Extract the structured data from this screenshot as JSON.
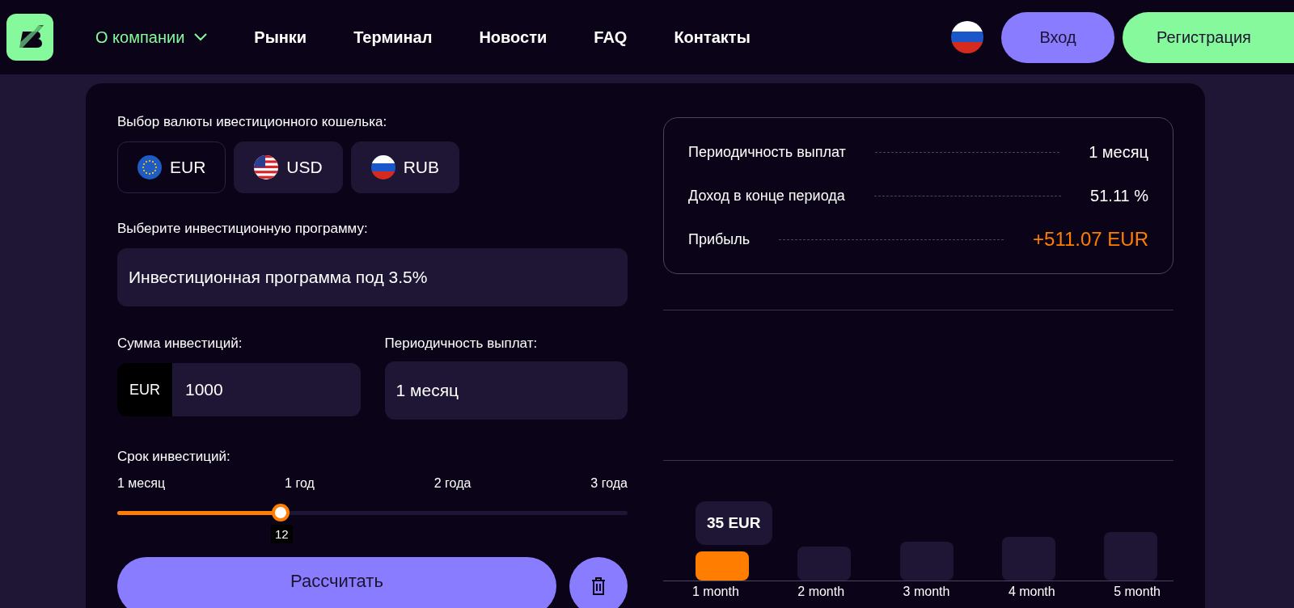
{
  "nav": {
    "items": [
      {
        "label": "О компании",
        "dropdown": true,
        "selected": true
      },
      {
        "label": "Рынки",
        "dropdown": false,
        "selected": false
      },
      {
        "label": "Терминал",
        "dropdown": false,
        "selected": false
      },
      {
        "label": "Новости",
        "dropdown": false,
        "selected": false
      },
      {
        "label": "FAQ",
        "dropdown": false,
        "selected": false
      },
      {
        "label": "Контакты",
        "dropdown": false,
        "selected": false
      }
    ],
    "login": "Вход",
    "register": "Регистрация"
  },
  "calculator": {
    "currency_label": "Выбор валюты ивестиционного кошелька:",
    "currencies": [
      {
        "code": "EUR",
        "kind": "eu",
        "selected": true
      },
      {
        "code": "USD",
        "kind": "us",
        "selected": false
      },
      {
        "code": "RUB",
        "kind": "ru",
        "selected": false
      }
    ],
    "program_label": "Выберите инвестиционную программу:",
    "program": "Инвестиционная программа под 3.5%",
    "amount_label": "Сумма инвестиций:",
    "amount_currency": "EUR",
    "amount": "1000",
    "period_label": "Периодичность выплат:",
    "period": "1 месяц",
    "term_label": "Срок инвестиций:",
    "term_ticks": [
      "1 месяц",
      "1 год",
      "2 года",
      "3 года"
    ],
    "term": {
      "level": 0.32,
      "value": "12"
    },
    "calculate": "Рассчитать"
  },
  "results": {
    "rows": [
      {
        "label": "Периодичность выплат",
        "value": "1 месяц",
        "highlight": false
      },
      {
        "label": "Доход в конце периода",
        "value": "51.11 %",
        "highlight": false
      },
      {
        "label": "Прибыль",
        "value": "+511.07 EUR",
        "highlight": true
      }
    ],
    "bars": [
      {
        "label": "1 month",
        "selected": true
      },
      {
        "label": "2 month",
        "selected": false
      },
      {
        "label": "3 month",
        "selected": false
      },
      {
        "label": "4 month",
        "selected": false
      },
      {
        "label": "5 month",
        "selected": false
      }
    ],
    "tooltip": "35 EUR"
  }
}
